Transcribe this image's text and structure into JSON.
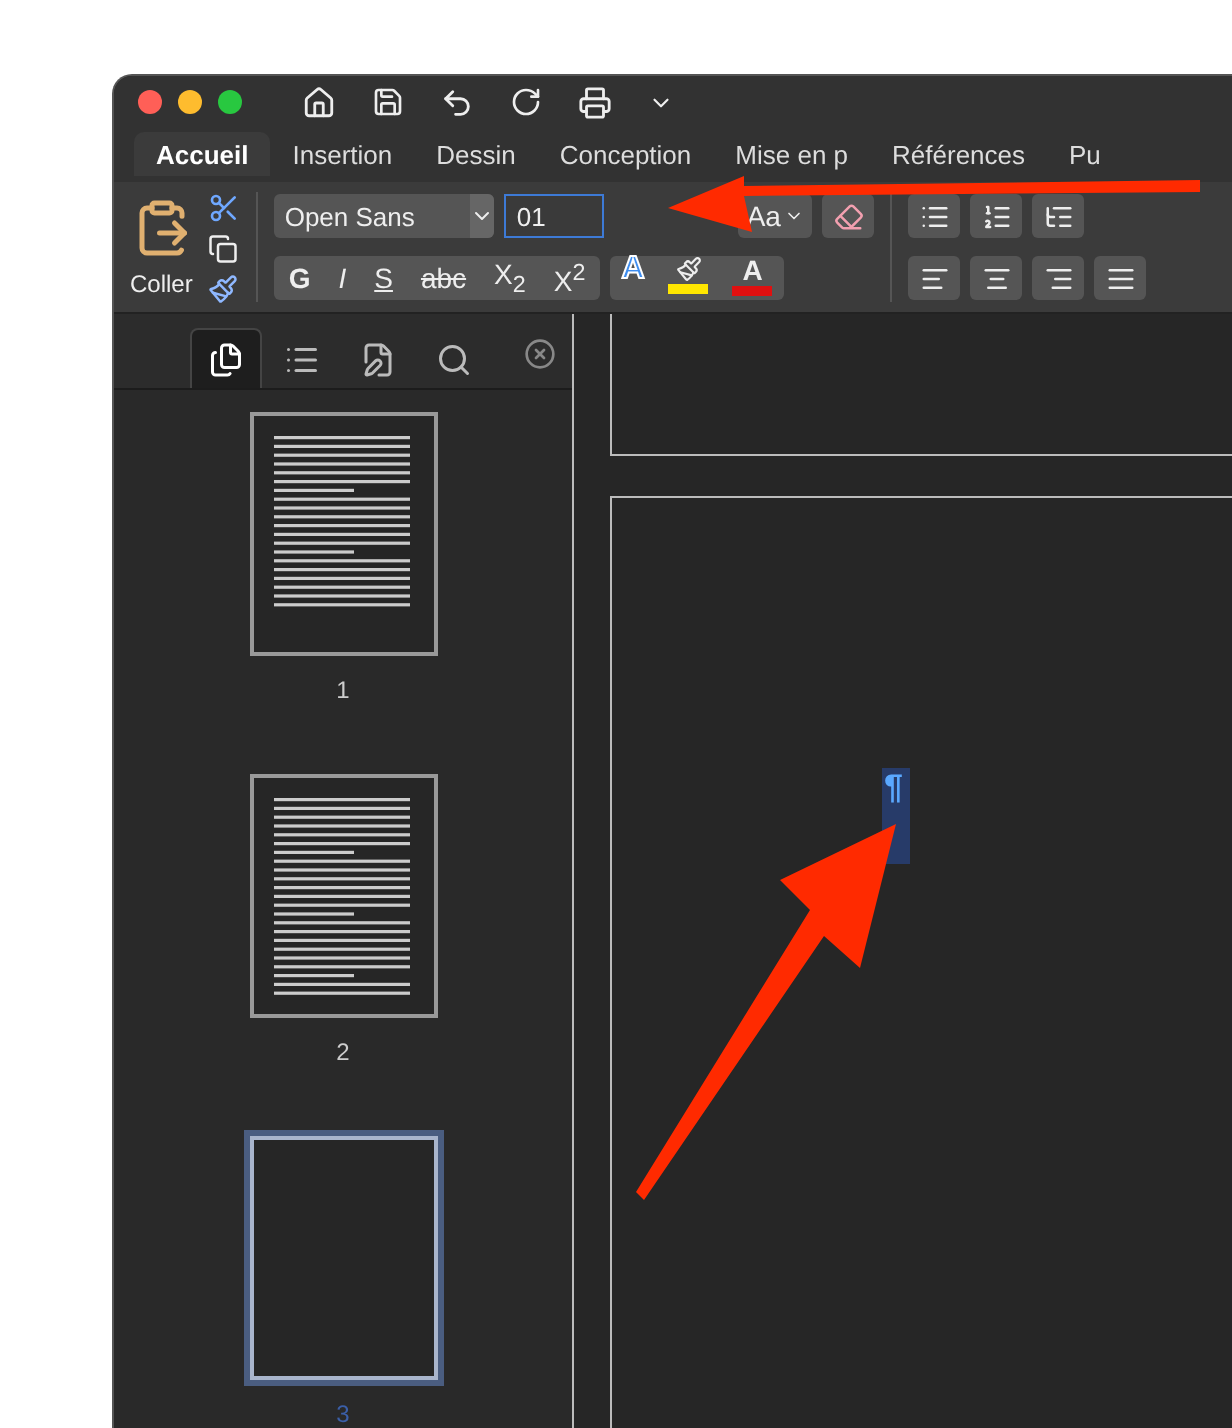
{
  "tabs": [
    {
      "label": "Accueil",
      "selected": true
    },
    {
      "label": "Insertion",
      "selected": false
    },
    {
      "label": "Dessin",
      "selected": false
    },
    {
      "label": "Conception",
      "selected": false
    },
    {
      "label": "Mise en p",
      "selected": false
    },
    {
      "label": "Références",
      "selected": false
    },
    {
      "label": "Pu",
      "selected": false
    }
  ],
  "clipboard": {
    "paste_label": "Coller"
  },
  "font": {
    "name": "Open Sans",
    "size": "01",
    "change_case": "Aa"
  },
  "format_buttons": [
    {
      "label": "G",
      "kind": "bold"
    },
    {
      "label": "I",
      "kind": "italic"
    },
    {
      "label": "S",
      "kind": "underline"
    },
    {
      "label": "abc",
      "kind": "strike"
    },
    {
      "label": "X$_{2}$",
      "kind": "script"
    },
    {
      "label": "X$^{2}$",
      "kind": "script"
    }
  ],
  "color_buttons": [
    {
      "kind": "effects",
      "label": "A"
    },
    {
      "kind": "highlight",
      "color": "#ffe600"
    },
    {
      "kind": "font_color",
      "label": "A",
      "color": "#e01010"
    }
  ],
  "nav_tabs": [
    {
      "kind": "thumbnails",
      "selected": true
    },
    {
      "kind": "outline",
      "selected": false
    },
    {
      "kind": "changes",
      "selected": false
    },
    {
      "kind": "search",
      "selected": false
    }
  ],
  "pages": [
    {
      "label": "1",
      "kind": "text",
      "selected": false
    },
    {
      "label": "2",
      "kind": "text",
      "selected": false
    },
    {
      "label": "3",
      "kind": "blank",
      "selected": true
    }
  ],
  "document": {
    "pilcrow": "¶"
  }
}
